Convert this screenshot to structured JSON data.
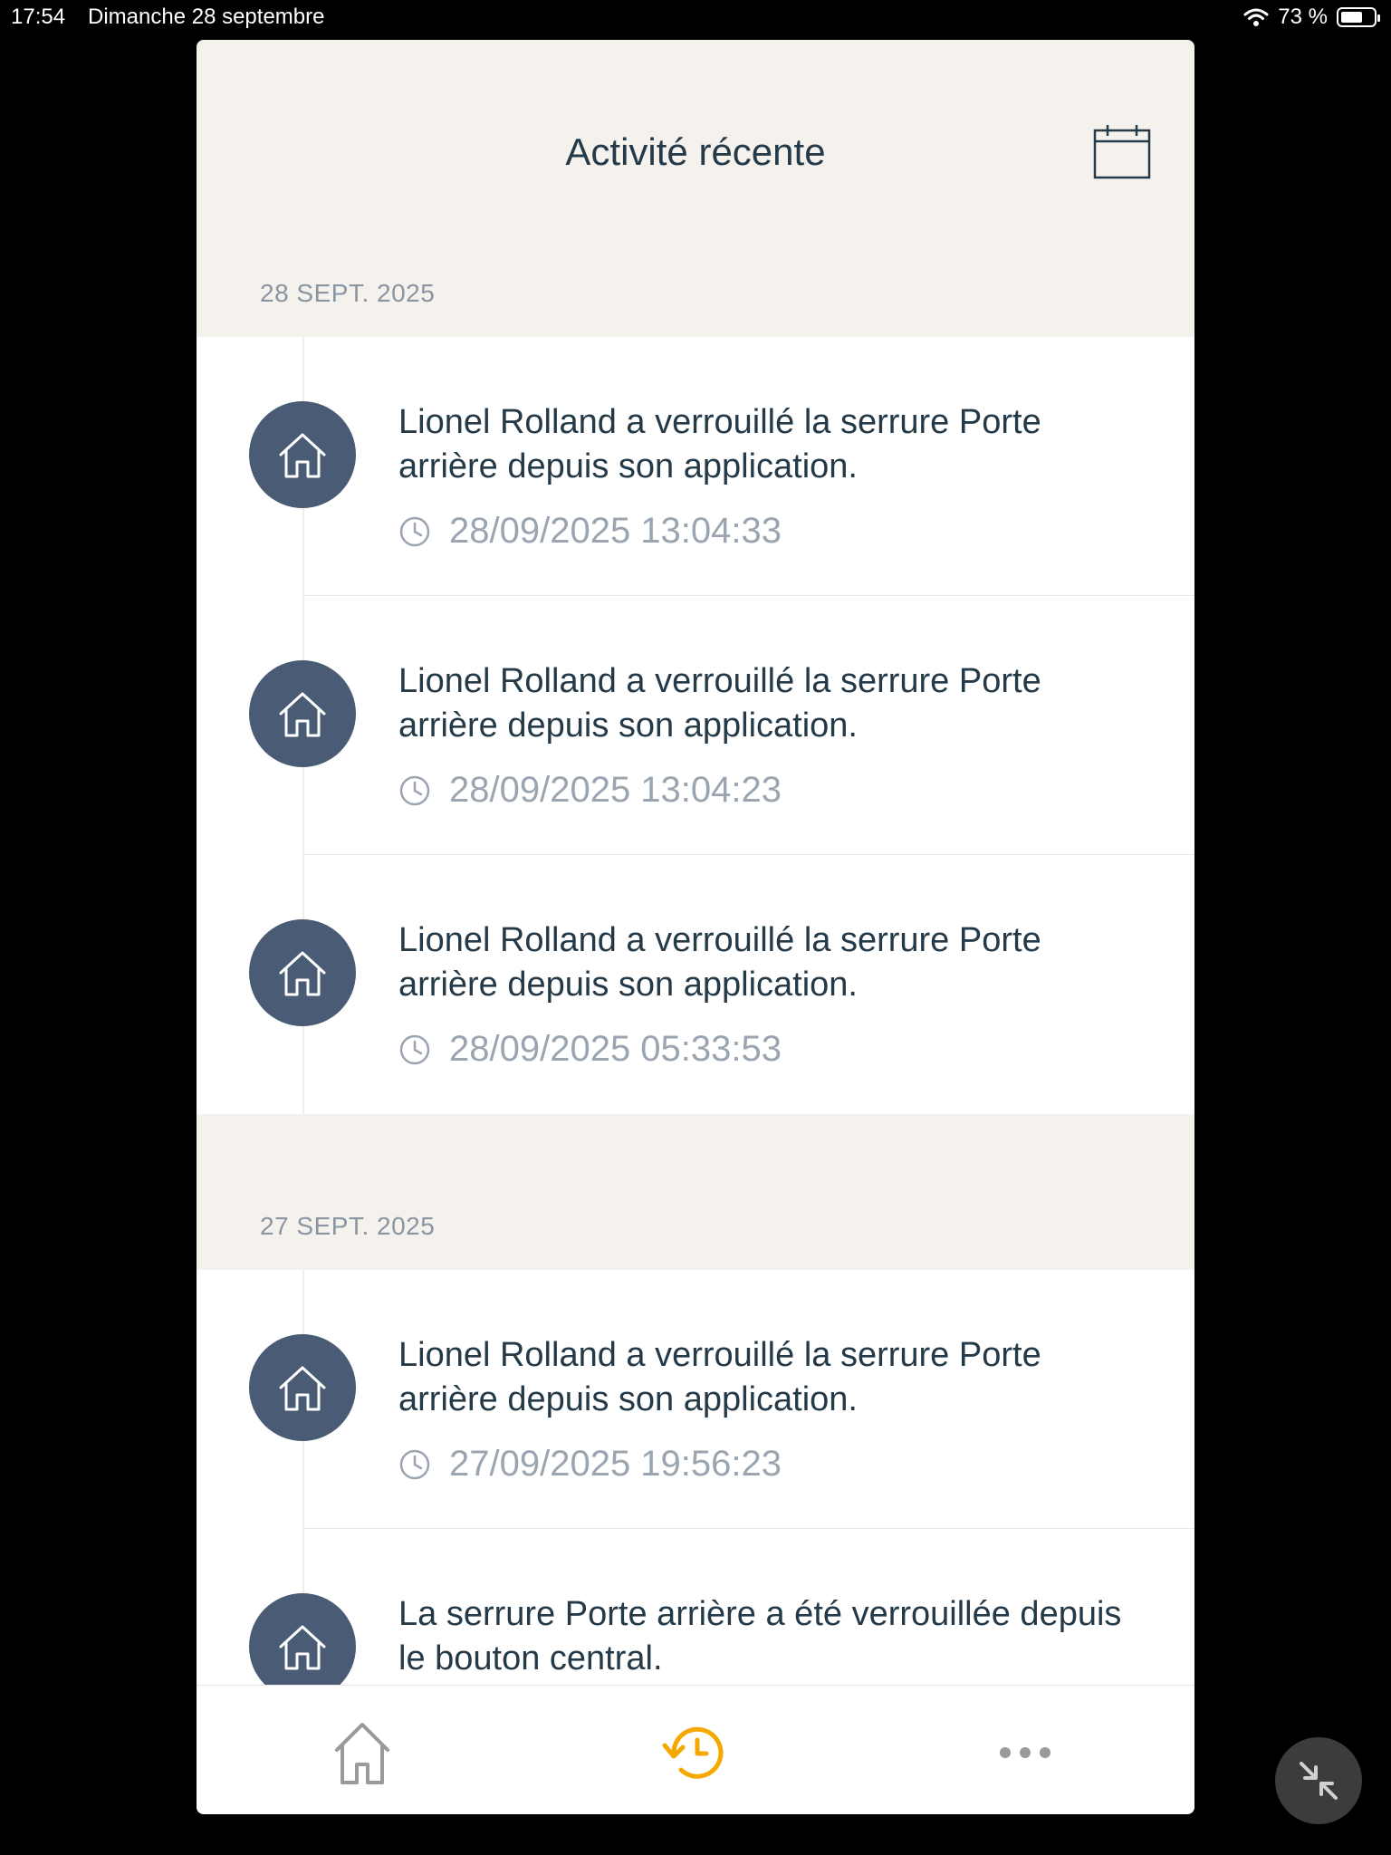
{
  "status_bar": {
    "time": "17:54",
    "date": "Dimanche 28 septembre",
    "battery": "73 %",
    "battery_level": 0.73
  },
  "header": {
    "title": "Activité récente",
    "calendar_icon": "calendar-icon"
  },
  "groups": [
    {
      "date": "28 SEPT. 2025",
      "events": [
        {
          "text": "Lionel Rolland a verrouillé la serrure Porte arrière depuis son application.",
          "time": "28/09/2025 13:04:33"
        },
        {
          "text": "Lionel Rolland a verrouillé la serrure Porte arrière depuis son application.",
          "time": "28/09/2025 13:04:23"
        },
        {
          "text": "Lionel Rolland a verrouillé la serrure Porte arrière depuis son application.",
          "time": "28/09/2025 05:33:53"
        }
      ]
    },
    {
      "date": "27 SEPT. 2025",
      "events": [
        {
          "text": "Lionel Rolland a verrouillé la serrure Porte arrière depuis son application.",
          "time": "27/09/2025 19:56:23"
        },
        {
          "text": "La serrure Porte arrière a été verrouillée depuis le bouton central.",
          "time": ""
        }
      ]
    }
  ],
  "tabbar": {
    "items": [
      "home-icon",
      "activity-history-icon",
      "more-icon"
    ],
    "active": "activity-history-icon"
  },
  "colors": {
    "accent": "#f5a800",
    "avatar": "#4a5c75",
    "header_bg": "#f5f2ee",
    "text": "#253a48",
    "muted": "#9aa5b1"
  }
}
